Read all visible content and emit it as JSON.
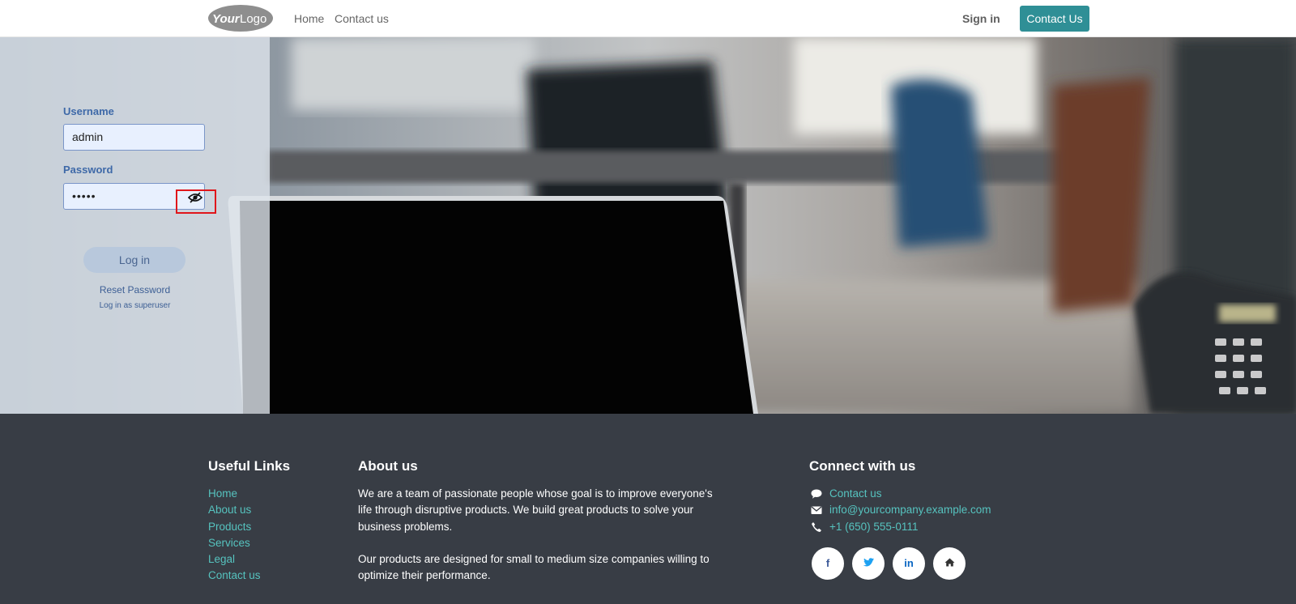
{
  "header": {
    "logo_text": "YourLogo",
    "nav": [
      {
        "label": "Home"
      },
      {
        "label": "Contact us"
      }
    ],
    "signin_label": "Sign in",
    "cta_label": "Contact Us"
  },
  "login": {
    "username_label": "Username",
    "username_value": "admin",
    "password_label": "Password",
    "password_value": "•••••",
    "password_toggle_icon": "eye-slash-icon",
    "login_button": "Log in",
    "reset_link": "Reset Password",
    "superuser_link": "Log in as superuser"
  },
  "footer": {
    "links_heading": "Useful Links",
    "links": [
      "Home",
      "About us",
      "Products",
      "Services",
      "Legal",
      "Contact us"
    ],
    "about_heading": "About us",
    "about_p1": "We are a team of passionate people whose goal is to improve everyone's life through disruptive products. We build great products to solve your business problems.",
    "about_p2": "Our products are designed for small to medium size companies willing to optimize their performance.",
    "connect_heading": "Connect with us",
    "connect": [
      {
        "icon": "comment-icon",
        "label": "Contact us"
      },
      {
        "icon": "envelope-icon",
        "label": "info@yourcompany.example.com"
      },
      {
        "icon": "phone-icon",
        "label": "+1 (650) 555-0111"
      }
    ],
    "socials": [
      {
        "icon": "facebook-icon",
        "glyph": "f"
      },
      {
        "icon": "twitter-icon",
        "glyph": ""
      },
      {
        "icon": "linkedin-icon",
        "glyph": "in"
      },
      {
        "icon": "home-icon",
        "glyph": ""
      }
    ]
  },
  "colors": {
    "accent": "#2f8f96",
    "footer_bg": "#383d45",
    "footer_link": "#56c3bf",
    "highlight": "#e0161b"
  }
}
